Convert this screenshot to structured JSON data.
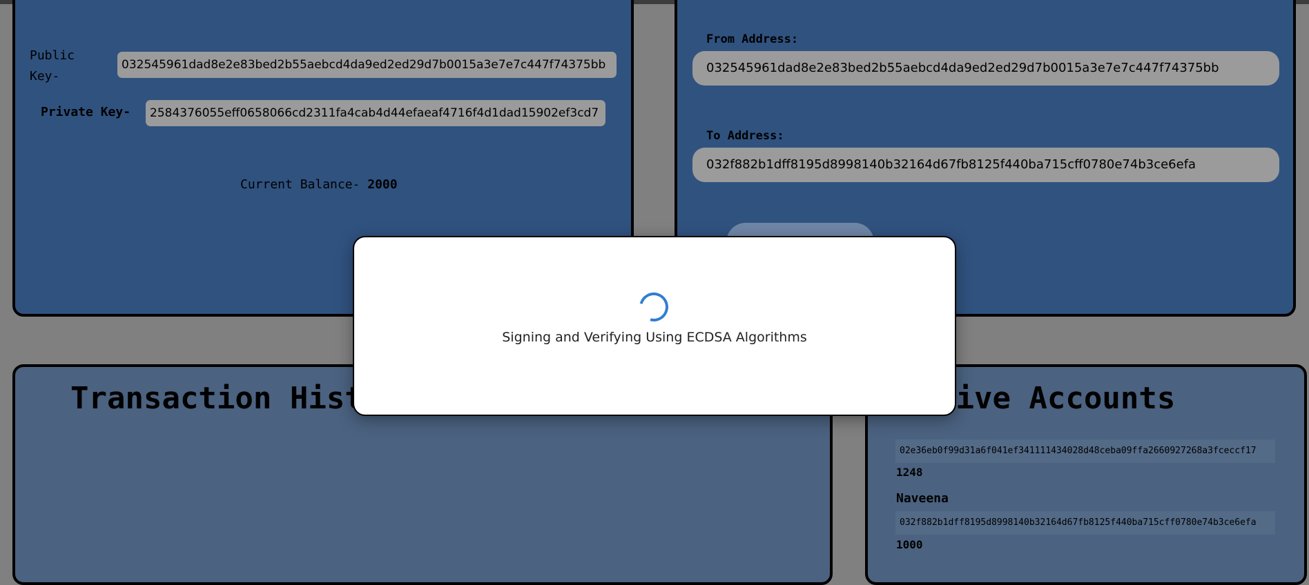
{
  "wallet": {
    "public_key_label_line1": "Public",
    "public_key_label_line2": "Key-",
    "public_key": "032545961dad8e2e83bed2b55aebcd4da9ed2ed29d7b0015a3e7e7c447f74375bb",
    "private_key_label": "Private Key-",
    "private_key": "2584376055eff0658066cd2311fa4cab4d44efaeaf4716f4d1dad15902ef3cd7",
    "balance_label": "Current Balance- ",
    "balance_value": "2000"
  },
  "transfer": {
    "from_label": "From Address:",
    "from_value": "032545961dad8e2e83bed2b55aebcd4da9ed2ed29d7b0015a3e7e7c447f74375bb",
    "to_label": "To Address:",
    "to_value": "032f882b1dff8195d8998140b32164d67fb8125f440ba715cff0780e74b3ce6efa"
  },
  "history": {
    "title": "Transaction History"
  },
  "accounts": {
    "title": "Active Accounts",
    "items": [
      {
        "key": "02e36eb0f99d31a6f041ef341111434028d48ceba09ffa2660927268a3fceccf17",
        "balance": "1248"
      },
      {
        "name": "Naveena",
        "key": "032f882b1dff8195d8998140b32164d67fb8125f440ba715cff0780e74b3ce6efa",
        "balance": "1000"
      }
    ]
  },
  "modal": {
    "message": "Signing and Verifying Using ECDSA Algorithms",
    "spinner_color": "#2f7fd0"
  },
  "colors": {
    "backdrop": "#808080",
    "panel_top": "#30527f",
    "panel_bottom": "#4b6280",
    "input_bg": "#9b9b9b"
  }
}
